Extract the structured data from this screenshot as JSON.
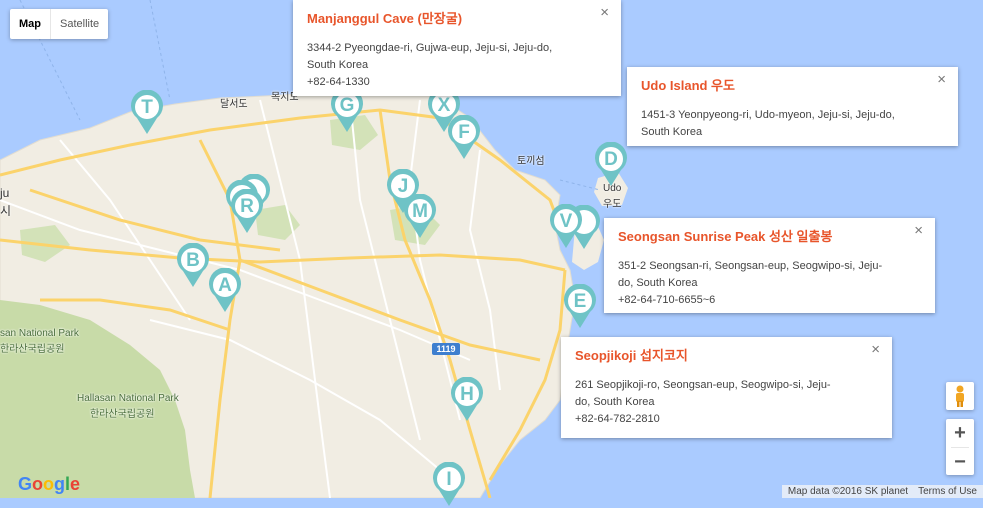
{
  "map_type": {
    "options": [
      "Map",
      "Satellite"
    ],
    "selected": "Map"
  },
  "markers": [
    "T",
    "G",
    "X",
    "F",
    "J",
    "M",
    "R",
    "B",
    "A",
    "D",
    "V",
    "E",
    "H",
    "I"
  ],
  "info_windows": [
    {
      "title": "Manjanggul Cave (만장굴)",
      "lines": [
        "3344-2 Pyeongdae-ri, Gujwa-eup, Jeju-si, Jeju-do,",
        "South Korea",
        "+82-64-1330"
      ]
    },
    {
      "title": "Udo Island 우도",
      "lines": [
        "1451-3 Yeonpyeong-ri, Udo-myeon, Jeju-si, Jeju-do,",
        "South Korea"
      ]
    },
    {
      "title": "Seongsan Sunrise Peak 성산 일출봉",
      "lines": [
        "351-2 Seongsan-ri, Seongsan-eup, Seogwipo-si, Jeju-",
        "do, South Korea",
        "+82-64-710-6655~6"
      ]
    },
    {
      "title": "Seopjikoji 섭지코지",
      "lines": [
        "261 Seopjikoji-ro, Seongsan-eup, Seogwipo-si, Jeju-",
        "do, South Korea",
        "+82-64-782-2810"
      ]
    }
  ],
  "close_glyph": "×",
  "map_labels": {
    "dalseodo": "달서도",
    "mokjido": "목지도",
    "tokkiseom": "토끼섬",
    "udo_en": "Udo",
    "udo_ko": "우도",
    "ju": "ju",
    "si": "시",
    "hallasan_park_1": "san National Park",
    "hallasan_park_1_ko": "한라산국립공원",
    "hallasan_park_2": "Hallasan National Park",
    "hallasan_park_2_ko": "한라산국립공원",
    "road_1119": "1119"
  },
  "controls": {
    "zoom_in": "+",
    "zoom_out": "−"
  },
  "footer": {
    "logo": "Google",
    "map_data": "Map data ©2016 SK planet",
    "terms": "Terms of Use"
  },
  "colors": {
    "water": "#aacbff",
    "land": "#f1ede3",
    "park": "#c8dba8",
    "road_major": "#fbd36b",
    "road_minor": "#ffffff",
    "marker": "#6fc3c6",
    "title": "#e8552b"
  }
}
